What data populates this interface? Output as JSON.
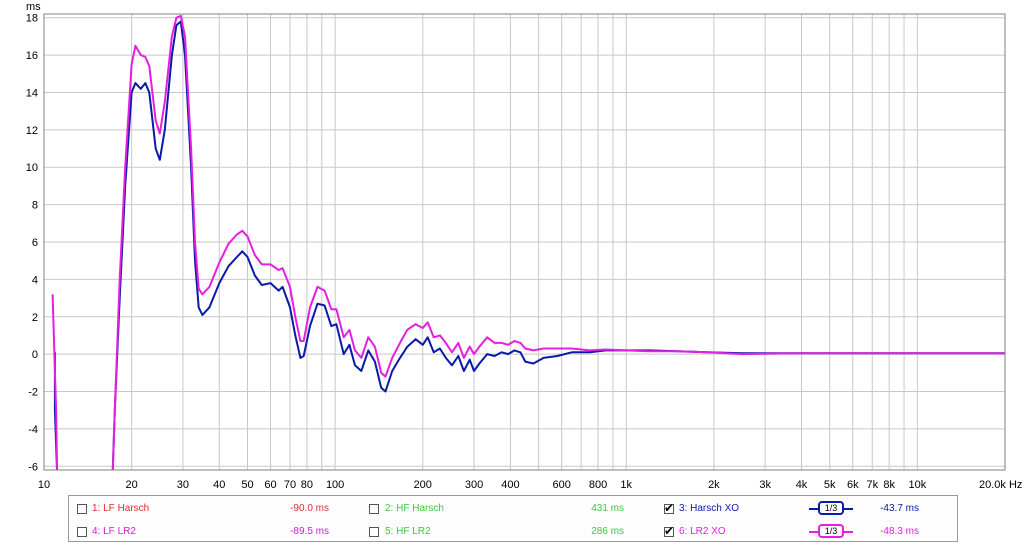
{
  "chart_data": {
    "type": "line",
    "ylabel": "ms",
    "xunit": "Hz",
    "xscale": "log",
    "xlim": [
      10,
      20000
    ],
    "ylim": [
      -6.2,
      18.2
    ],
    "yticks": [
      18,
      16,
      14,
      12,
      10,
      8,
      6,
      4,
      2,
      0,
      -2,
      -4,
      -6
    ],
    "xticks": [
      {
        "v": 10,
        "label": "10"
      },
      {
        "v": 20,
        "label": "20"
      },
      {
        "v": 30,
        "label": "30"
      },
      {
        "v": 40,
        "label": "40"
      },
      {
        "v": 50,
        "label": "50"
      },
      {
        "v": 60,
        "label": "60"
      },
      {
        "v": 70,
        "label": "70"
      },
      {
        "v": 80,
        "label": "80"
      },
      {
        "v": 100,
        "label": "100"
      },
      {
        "v": 200,
        "label": "200"
      },
      {
        "v": 300,
        "label": "300"
      },
      {
        "v": 400,
        "label": "400"
      },
      {
        "v": 600,
        "label": "600"
      },
      {
        "v": 800,
        "label": "800"
      },
      {
        "v": 1000,
        "label": "1k"
      },
      {
        "v": 2000,
        "label": "2k"
      },
      {
        "v": 3000,
        "label": "3k"
      },
      {
        "v": 4000,
        "label": "4k"
      },
      {
        "v": 5000,
        "label": "5k"
      },
      {
        "v": 6000,
        "label": "6k"
      },
      {
        "v": 7000,
        "label": "7k"
      },
      {
        "v": 8000,
        "label": "8k"
      },
      {
        "v": 10000,
        "label": "10k"
      },
      {
        "v": 20000,
        "label": "20.0k Hz"
      }
    ],
    "grid": true,
    "series": [
      {
        "name": "3: Harsch XO",
        "color": "#0a1aa8",
        "points": [
          [
            10.9,
            0.1
          ],
          [
            10.9,
            -3.0
          ],
          [
            11.1,
            -6.5
          ],
          [
            17.2,
            -6.5
          ],
          [
            17.5,
            -3.0
          ],
          [
            18.2,
            3.0
          ],
          [
            19.0,
            9.0
          ],
          [
            20.0,
            14.0
          ],
          [
            20.6,
            14.5
          ],
          [
            21.5,
            14.2
          ],
          [
            22.3,
            14.5
          ],
          [
            23.0,
            14.0
          ],
          [
            24.2,
            11.0
          ],
          [
            25.0,
            10.4
          ],
          [
            26.0,
            12.0
          ],
          [
            27.5,
            16.0
          ],
          [
            28.5,
            17.6
          ],
          [
            29.5,
            17.8
          ],
          [
            30.5,
            16.0
          ],
          [
            32.0,
            10.0
          ],
          [
            33.0,
            5.0
          ],
          [
            34.0,
            2.5
          ],
          [
            35.0,
            2.1
          ],
          [
            37.0,
            2.5
          ],
          [
            40.0,
            3.8
          ],
          [
            43.0,
            4.7
          ],
          [
            46.0,
            5.2
          ],
          [
            48.0,
            5.5
          ],
          [
            50.0,
            5.2
          ],
          [
            53.0,
            4.2
          ],
          [
            56.0,
            3.7
          ],
          [
            60.0,
            3.8
          ],
          [
            64.0,
            3.4
          ],
          [
            66.0,
            3.6
          ],
          [
            70.0,
            2.5
          ],
          [
            73.0,
            1.0
          ],
          [
            76.0,
            -0.2
          ],
          [
            78.0,
            -0.1
          ],
          [
            82.0,
            1.5
          ],
          [
            87.0,
            2.7
          ],
          [
            92.0,
            2.6
          ],
          [
            97.0,
            1.5
          ],
          [
            101.0,
            1.6
          ],
          [
            107.0,
            0.0
          ],
          [
            112.0,
            0.5
          ],
          [
            117.0,
            -0.6
          ],
          [
            123.0,
            -0.9
          ],
          [
            130.0,
            0.2
          ],
          [
            137.0,
            -0.4
          ],
          [
            144.0,
            -1.8
          ],
          [
            149.0,
            -2.0
          ],
          [
            157.0,
            -0.9
          ],
          [
            167.0,
            -0.2
          ],
          [
            177.0,
            0.4
          ],
          [
            189.0,
            0.8
          ],
          [
            200.0,
            0.5
          ],
          [
            208.0,
            0.9
          ],
          [
            218.0,
            0.1
          ],
          [
            229.0,
            0.3
          ],
          [
            240.0,
            -0.2
          ],
          [
            252.0,
            -0.6
          ],
          [
            265.0,
            -0.1
          ],
          [
            277.0,
            -0.9
          ],
          [
            290.0,
            -0.3
          ],
          [
            300.0,
            -0.9
          ],
          [
            313.0,
            -0.5
          ],
          [
            333.0,
            0.0
          ],
          [
            353.0,
            -0.1
          ],
          [
            373.0,
            0.1
          ],
          [
            393.0,
            0.0
          ],
          [
            413.0,
            0.2
          ],
          [
            433.0,
            0.1
          ],
          [
            450.0,
            -0.4
          ],
          [
            480.0,
            -0.5
          ],
          [
            520.0,
            -0.2
          ],
          [
            580.0,
            -0.1
          ],
          [
            650.0,
            0.1
          ],
          [
            750.0,
            0.1
          ],
          [
            850.0,
            0.2
          ],
          [
            1000.0,
            0.2
          ],
          [
            1200.0,
            0.2
          ],
          [
            1500.0,
            0.15
          ],
          [
            1900.0,
            0.1
          ],
          [
            2500.0,
            0.05
          ],
          [
            4000.0,
            0.05
          ],
          [
            6000.0,
            0.05
          ],
          [
            10000.0,
            0.05
          ],
          [
            20000.0,
            0.05
          ]
        ]
      },
      {
        "name": "6: LR2 XO",
        "color": "#e51ee0",
        "points": [
          [
            10.7,
            3.2
          ],
          [
            11.0,
            -3.0
          ],
          [
            11.1,
            -6.5
          ],
          [
            17.2,
            -6.5
          ],
          [
            17.5,
            -3.0
          ],
          [
            18.2,
            4.0
          ],
          [
            19.0,
            10.0
          ],
          [
            20.0,
            15.5
          ],
          [
            20.6,
            16.5
          ],
          [
            21.5,
            16.0
          ],
          [
            22.3,
            15.9
          ],
          [
            23.0,
            15.4
          ],
          [
            24.2,
            12.5
          ],
          [
            25.0,
            11.8
          ],
          [
            26.0,
            13.5
          ],
          [
            27.5,
            17.0
          ],
          [
            28.5,
            18.0
          ],
          [
            29.5,
            18.1
          ],
          [
            30.5,
            17.0
          ],
          [
            32.0,
            11.0
          ],
          [
            33.0,
            6.0
          ],
          [
            34.0,
            3.5
          ],
          [
            35.0,
            3.2
          ],
          [
            37.0,
            3.6
          ],
          [
            40.0,
            4.9
          ],
          [
            43.0,
            5.9
          ],
          [
            46.0,
            6.4
          ],
          [
            48.0,
            6.6
          ],
          [
            50.0,
            6.3
          ],
          [
            53.0,
            5.3
          ],
          [
            56.0,
            4.8
          ],
          [
            60.0,
            4.8
          ],
          [
            64.0,
            4.5
          ],
          [
            66.0,
            4.6
          ],
          [
            70.0,
            3.6
          ],
          [
            73.0,
            2.0
          ],
          [
            76.0,
            0.7
          ],
          [
            78.0,
            0.7
          ],
          [
            82.0,
            2.5
          ],
          [
            87.0,
            3.6
          ],
          [
            92.0,
            3.4
          ],
          [
            97.0,
            2.4
          ],
          [
            101.0,
            2.4
          ],
          [
            107.0,
            0.9
          ],
          [
            112.0,
            1.3
          ],
          [
            117.0,
            0.2
          ],
          [
            123.0,
            -0.2
          ],
          [
            130.0,
            0.9
          ],
          [
            137.0,
            0.4
          ],
          [
            144.0,
            -1.0
          ],
          [
            149.0,
            -1.2
          ],
          [
            157.0,
            -0.2
          ],
          [
            167.0,
            0.6
          ],
          [
            177.0,
            1.3
          ],
          [
            189.0,
            1.6
          ],
          [
            200.0,
            1.4
          ],
          [
            208.0,
            1.7
          ],
          [
            218.0,
            0.9
          ],
          [
            229.0,
            1.0
          ],
          [
            240.0,
            0.6
          ],
          [
            252.0,
            0.1
          ],
          [
            265.0,
            0.6
          ],
          [
            277.0,
            -0.2
          ],
          [
            290.0,
            0.4
          ],
          [
            300.0,
            0.0
          ],
          [
            313.0,
            0.4
          ],
          [
            333.0,
            0.9
          ],
          [
            353.0,
            0.6
          ],
          [
            373.0,
            0.6
          ],
          [
            393.0,
            0.5
          ],
          [
            413.0,
            0.7
          ],
          [
            433.0,
            0.6
          ],
          [
            450.0,
            0.3
          ],
          [
            480.0,
            0.2
          ],
          [
            520.0,
            0.3
          ],
          [
            580.0,
            0.3
          ],
          [
            650.0,
            0.3
          ],
          [
            750.0,
            0.2
          ],
          [
            850.0,
            0.25
          ],
          [
            1000.0,
            0.2
          ],
          [
            1200.0,
            0.15
          ],
          [
            1500.0,
            0.15
          ],
          [
            1900.0,
            0.1
          ],
          [
            2500.0,
            0.0
          ],
          [
            4000.0,
            0.05
          ],
          [
            6000.0,
            0.05
          ],
          [
            10000.0,
            0.05
          ],
          [
            20000.0,
            0.05
          ]
        ]
      }
    ]
  },
  "legend": {
    "rows": [
      {
        "items": [
          {
            "label": "1: LF Harsch",
            "value": "-90.0 ms",
            "color": "#e03030",
            "checked": false
          },
          {
            "label": "2: HF Harsch",
            "value": "431 ms",
            "color": "#3ec83e",
            "checked": false
          },
          {
            "label": "3: Harsch XO",
            "value": "-43.7 ms",
            "color": "#0a1aa8",
            "checked": true,
            "smoothing": "1/3"
          }
        ]
      },
      {
        "items": [
          {
            "label": "4: LF LR2",
            "value": "-89.5 ms",
            "color": "#d020d0",
            "checked": false
          },
          {
            "label": "5: HF LR2",
            "value": "286 ms",
            "color": "#3ec83e",
            "checked": false
          },
          {
            "label": "6: LR2 XO",
            "value": "-48.3 ms",
            "color": "#e51ee0",
            "checked": true,
            "smoothing": "1/3"
          }
        ]
      }
    ]
  }
}
